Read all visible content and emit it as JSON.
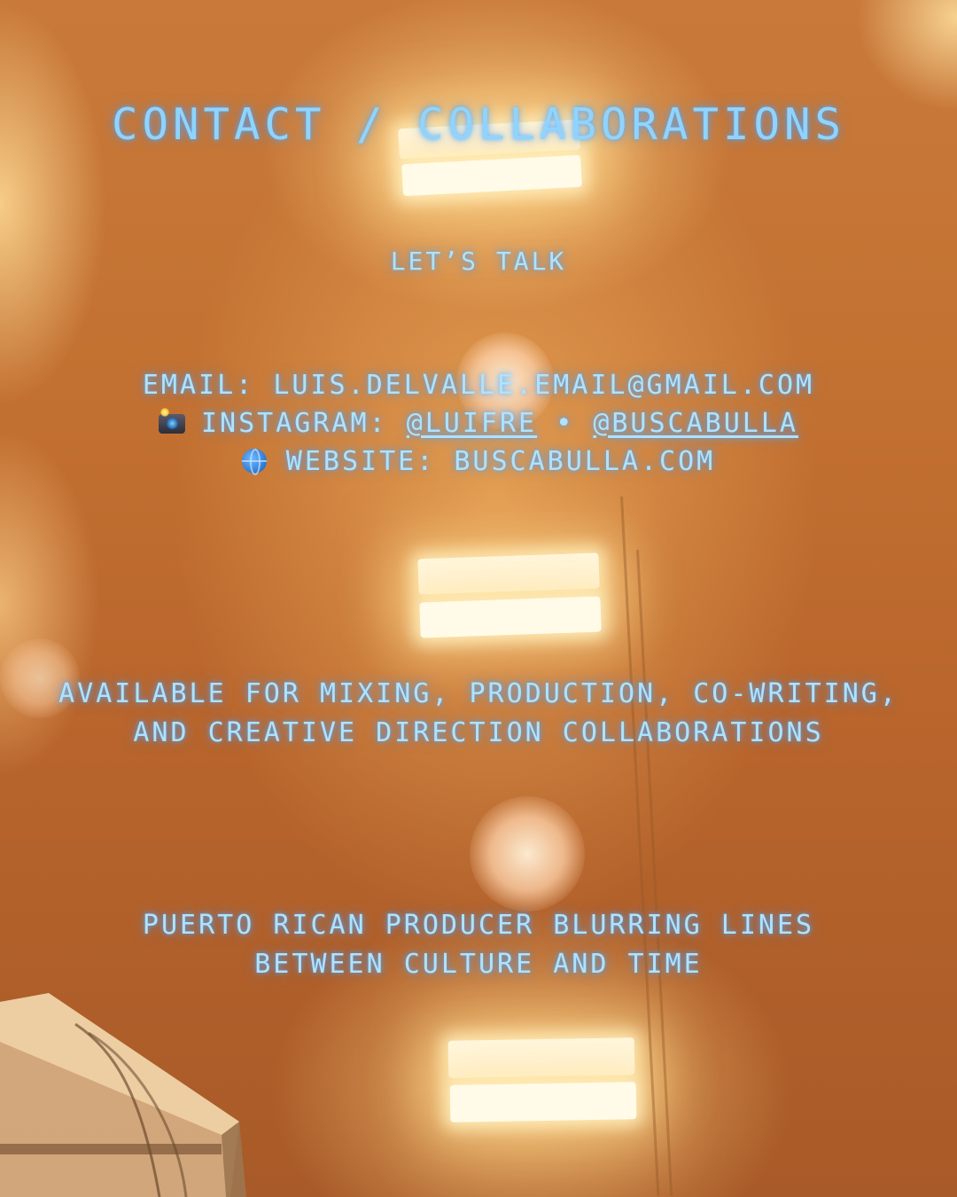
{
  "title": "CONTACT / COLLABORATIONS",
  "subtitle": "LET’S TALK",
  "contact": {
    "email_label": "EMAIL:",
    "email": "LUIS.DELVALLE.EMAIL@GMAIL.COM",
    "instagram_icon": "camera-flash-icon",
    "instagram_label": "INSTAGRAM:",
    "instagram_handle_1": "@LUIFRE",
    "separator": "•",
    "instagram_handle_2": "@BUSCABULLA",
    "website_icon": "globe-icon",
    "website_label": "WEBSITE:",
    "website": "BUSCABULLA.COM"
  },
  "services": {
    "line1": "AVAILABLE FOR MIXING, PRODUCTION, CO-WRITING,",
    "line2": "AND CREATIVE DIRECTION COLLABORATIONS"
  },
  "bio": {
    "line1": "PUERTO RICAN PRODUCER BLURRING LINES",
    "line2": "BETWEEN CULTURE AND TIME"
  },
  "colors": {
    "text_glow": "#aee3ff",
    "title": "#8fd4ff",
    "background": "#c9732e"
  }
}
